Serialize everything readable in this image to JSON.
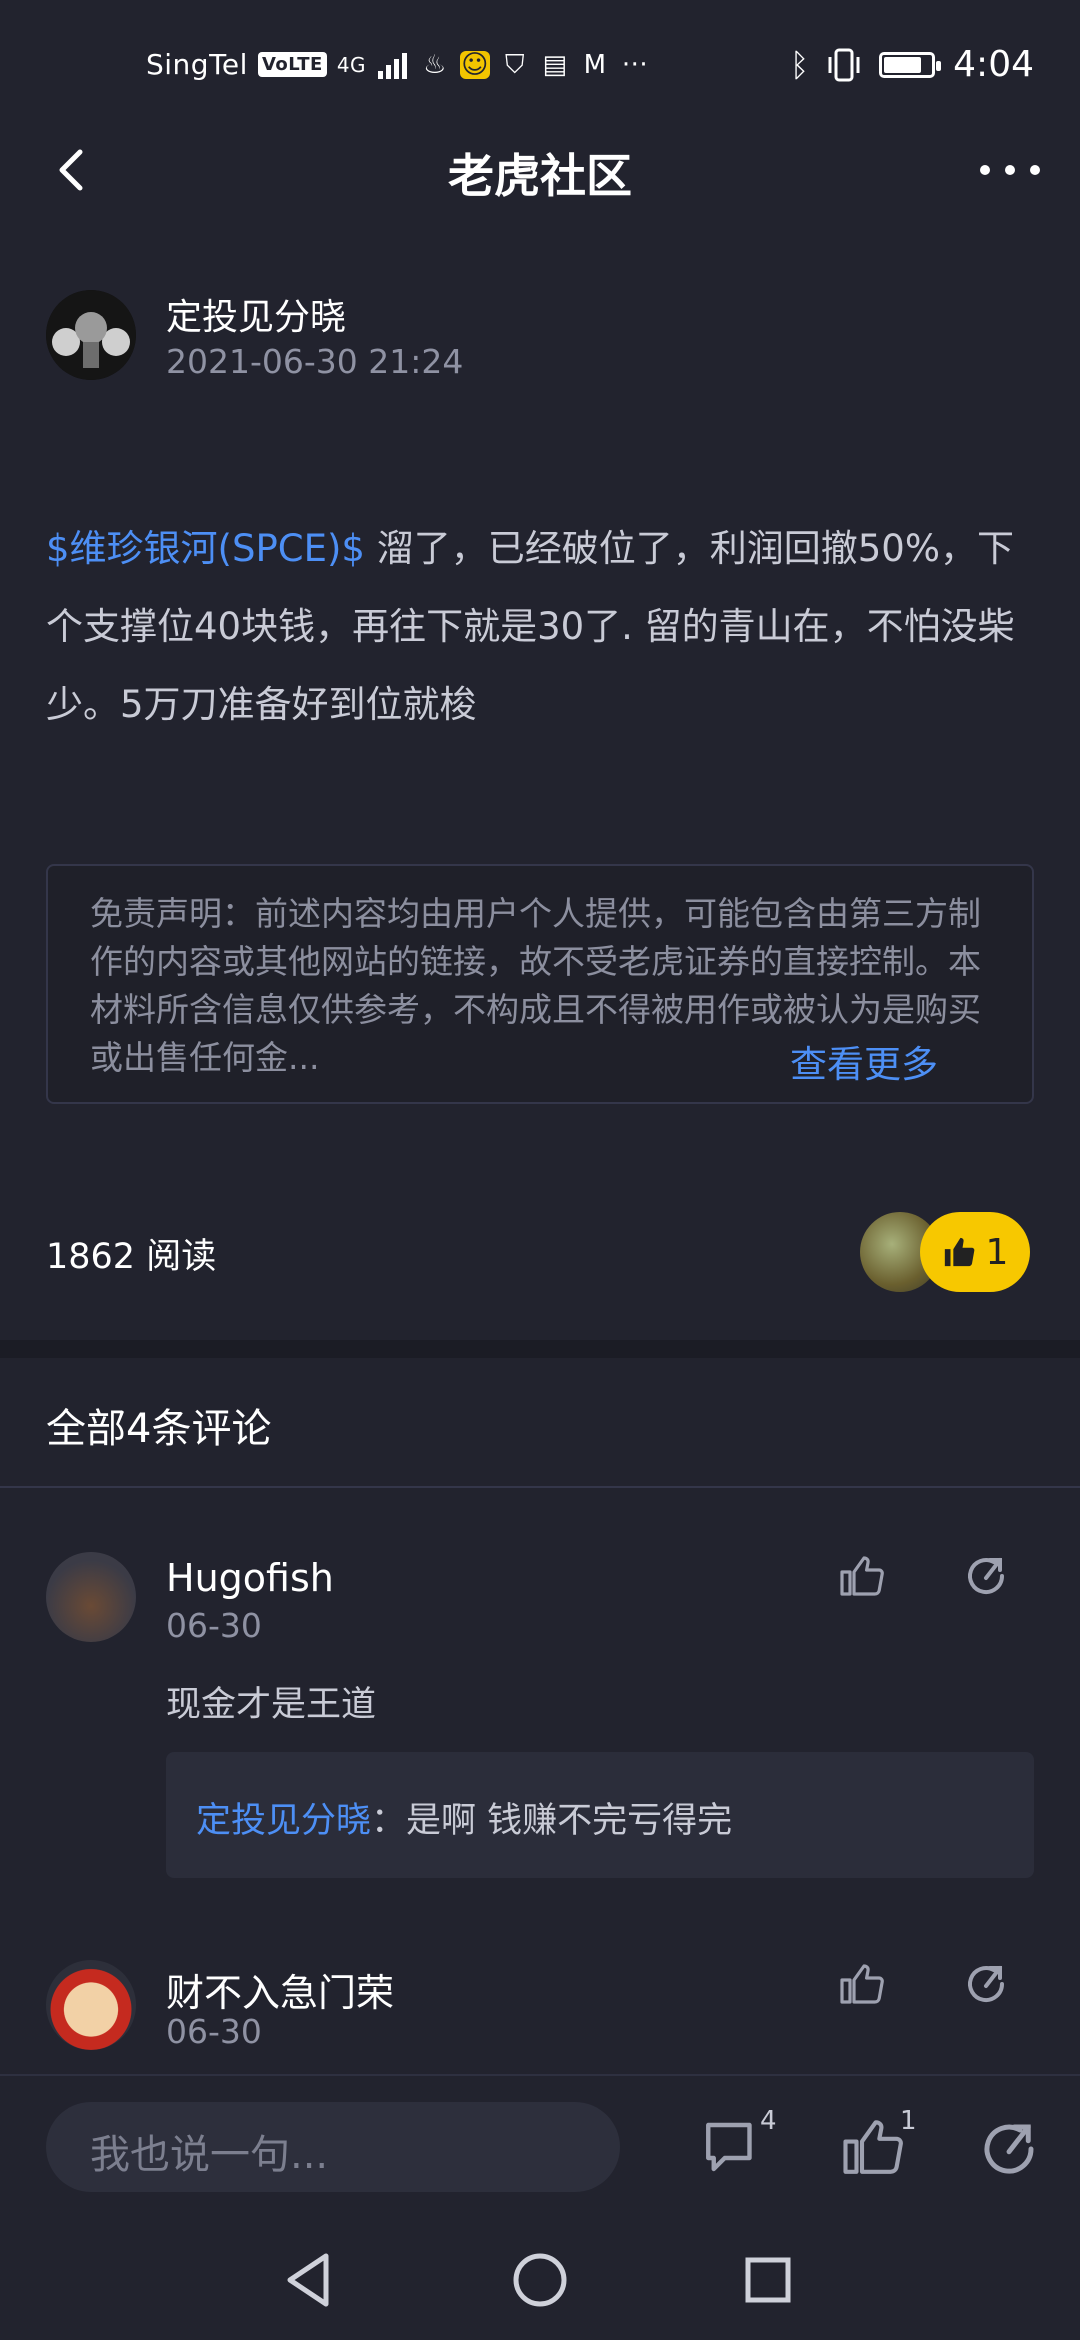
{
  "status_bar": {
    "carrier": "SingTel",
    "volte": "VoLTE",
    "network": "4G",
    "time": "4:04",
    "battery_level": 0.8
  },
  "header": {
    "title": "老虎社区",
    "back_icon": "chevron-left-icon",
    "more_icon": "more-horizontal-icon"
  },
  "post": {
    "author": "定投见分晓",
    "timestamp": "2021-06-30 21:24",
    "ticker": "$维珍银河(SPCE)$",
    "body": "溜了，已经破位了，利润回撤50%，下个支撑位40块钱，再往下就是30了. 留的青山在，不怕没柴少。5万刀准备好到位就梭",
    "disclaimer": "免责声明：前述内容均由用户个人提供，可能包含由第三方制作的内容或其他网站的链接，故不受老虎证券的直接控制。本材料所含信息仅供参考，不构成且不得被用作或被认为是购买或出售任何金...",
    "see_more": "查看更多",
    "reads": "1862 阅读",
    "like_count": "1"
  },
  "comments_header": "全部4条评论",
  "comments": [
    {
      "name": "Hugofish",
      "date": "06-30",
      "text": "现金才是王道",
      "reply_author": "定投见分晓",
      "reply_sep": "：",
      "reply_text": "是啊 钱赚不完亏得完"
    },
    {
      "name": "财不入急门荣",
      "date": "06-30"
    }
  ],
  "bottom_bar": {
    "input_placeholder": "我也说一句...",
    "comment_count": "4",
    "like_count": "1"
  },
  "colors": {
    "background": "#22232e",
    "accent_blue": "#4d8ff5",
    "like_yellow": "#f7c800"
  }
}
